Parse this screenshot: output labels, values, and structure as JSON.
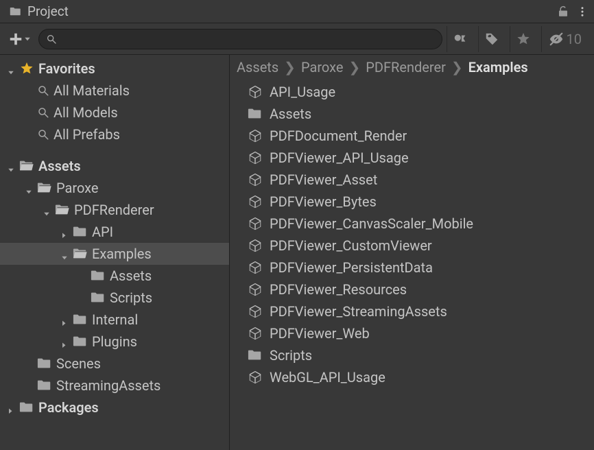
{
  "titlebar": {
    "title": "Project"
  },
  "toolbar": {
    "search_value": "",
    "search_placeholder": "",
    "hidden_count": "10"
  },
  "breadcrumb": {
    "items": [
      "Assets",
      "Paroxe",
      "PDFRenderer",
      "Examples"
    ],
    "separator": "❯"
  },
  "tree": {
    "favorites": {
      "label": "Favorites",
      "items": [
        {
          "label": "All Materials"
        },
        {
          "label": "All Models"
        },
        {
          "label": "All Prefabs"
        }
      ]
    },
    "assets": {
      "label": "Assets",
      "paroxe": {
        "label": "Paroxe"
      },
      "pdfrenderer": {
        "label": "PDFRenderer"
      },
      "api": {
        "label": "API"
      },
      "examples": {
        "label": "Examples"
      },
      "examples_assets": {
        "label": "Assets"
      },
      "examples_scripts": {
        "label": "Scripts"
      },
      "internal": {
        "label": "Internal"
      },
      "plugins": {
        "label": "Plugins"
      },
      "scenes": {
        "label": "Scenes"
      },
      "streaming": {
        "label": "StreamingAssets"
      }
    },
    "packages": {
      "label": "Packages"
    }
  },
  "content": {
    "items": [
      {
        "type": "unity",
        "label": "API_Usage"
      },
      {
        "type": "folder",
        "label": "Assets"
      },
      {
        "type": "unity",
        "label": "PDFDocument_Render"
      },
      {
        "type": "unity",
        "label": "PDFViewer_API_Usage"
      },
      {
        "type": "unity",
        "label": "PDFViewer_Asset"
      },
      {
        "type": "unity",
        "label": "PDFViewer_Bytes"
      },
      {
        "type": "unity",
        "label": "PDFViewer_CanvasScaler_Mobile"
      },
      {
        "type": "unity",
        "label": "PDFViewer_CustomViewer"
      },
      {
        "type": "unity",
        "label": "PDFViewer_PersistentData"
      },
      {
        "type": "unity",
        "label": "PDFViewer_Resources"
      },
      {
        "type": "unity",
        "label": "PDFViewer_StreamingAssets"
      },
      {
        "type": "unity",
        "label": "PDFViewer_Web"
      },
      {
        "type": "folder",
        "label": "Scripts"
      },
      {
        "type": "unity",
        "label": "WebGL_API_Usage"
      }
    ]
  }
}
